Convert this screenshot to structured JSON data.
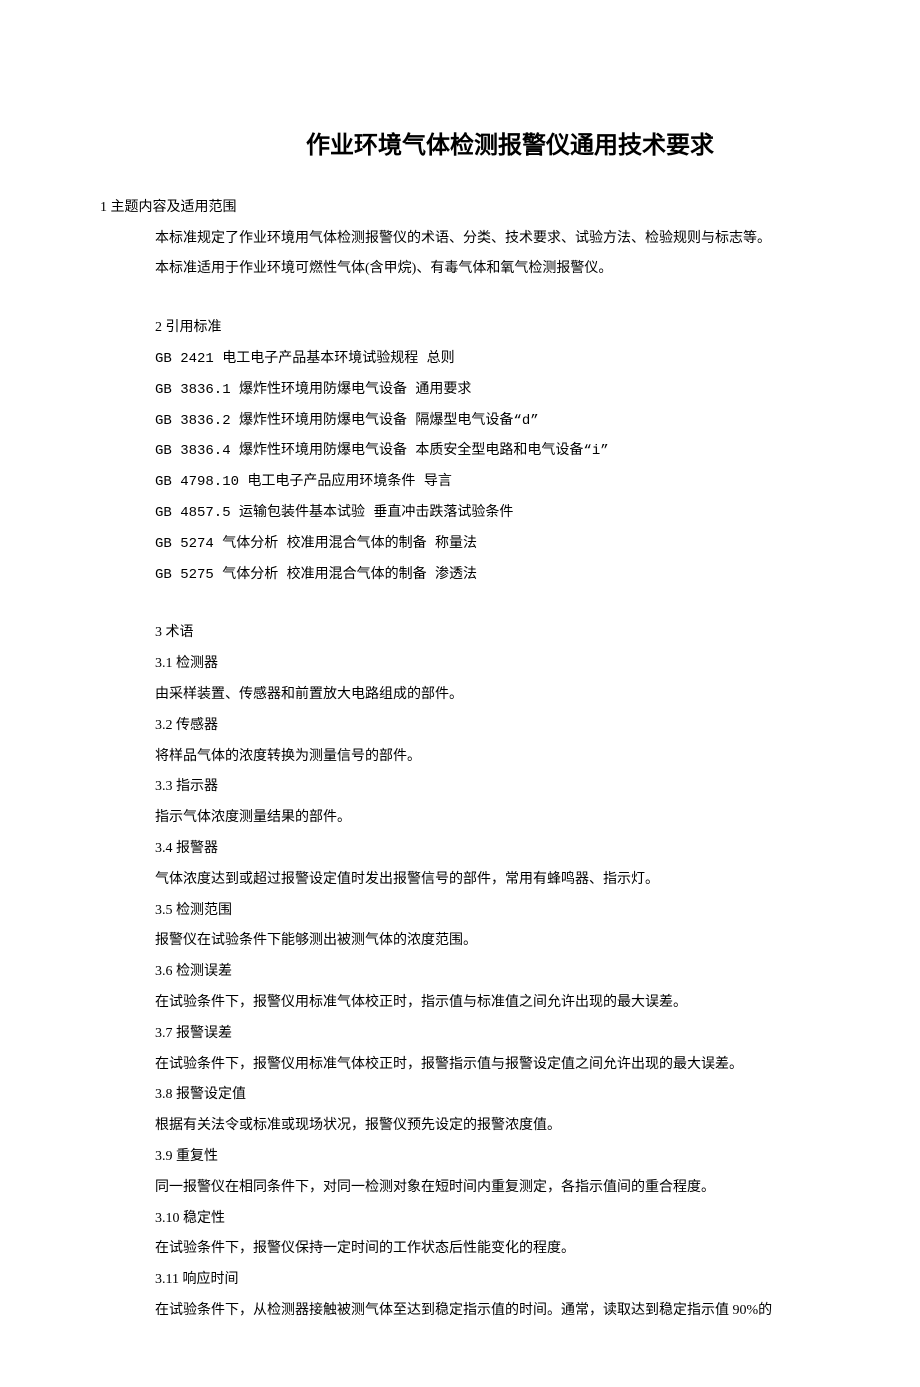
{
  "title": "作业环境气体检测报警仪通用技术要求",
  "section1": {
    "heading": "1  主题内容及适用范围",
    "para1": "本标准规定了作业环境用气体检测报警仪的术语、分类、技术要求、试验方法、检验规则与标志等。",
    "para2": "本标准适用于作业环境可燃性气体(含甲烷)、有毒气体和氧气检测报警仪。"
  },
  "section2": {
    "heading": "2  引用标准",
    "refs": [
      "GB 2421  电工电子产品基本环境试验规程  总则",
      "GB 3836.1  爆炸性环境用防爆电气设备  通用要求",
      "GB 3836.2  爆炸性环境用防爆电气设备  隔爆型电气设备“d”",
      "GB 3836.4  爆炸性环境用防爆电气设备  本质安全型电路和电气设备“i”",
      "GB 4798.10  电工电子产品应用环境条件  导言",
      "GB 4857.5  运输包装件基本试验  垂直冲击跌落试验条件",
      "GB 5274  气体分析  校准用混合气体的制备  称量法",
      "GB 5275  气体分析  校准用混合气体的制备  渗透法"
    ]
  },
  "section3": {
    "heading": "3  术语",
    "terms": [
      {
        "num": "3.1  检测器",
        "def": "由采样装置、传感器和前置放大电路组成的部件。"
      },
      {
        "num": "3.2  传感器",
        "def": "将样品气体的浓度转换为测量信号的部件。"
      },
      {
        "num": "3.3  指示器",
        "def": "指示气体浓度测量结果的部件。"
      },
      {
        "num": "3.4  报警器",
        "def": "气体浓度达到或超过报警设定值时发出报警信号的部件，常用有蜂鸣器、指示灯。"
      },
      {
        "num": "3.5  检测范围",
        "def": "报警仪在试验条件下能够测出被测气体的浓度范围。"
      },
      {
        "num": "3.6  检测误差",
        "def": "在试验条件下，报警仪用标准气体校正时，指示值与标准值之间允许出现的最大误差。"
      },
      {
        "num": "3.7  报警误差",
        "def": "在试验条件下，报警仪用标准气体校正时，报警指示值与报警设定值之间允许出现的最大误差。"
      },
      {
        "num": "3.8  报警设定值",
        "def": "根据有关法令或标准或现场状况，报警仪预先设定的报警浓度值。"
      },
      {
        "num": "3.9  重复性",
        "def": "同一报警仪在相同条件下，对同一检测对象在短时间内重复测定，各指示值间的重合程度。"
      },
      {
        "num": "3.10  稳定性",
        "def": "在试验条件下，报警仪保持一定时间的工作状态后性能变化的程度。"
      },
      {
        "num": "3.11  响应时间",
        "def": "在试验条件下，从检测器接触被测气体至达到稳定指示值的时间。通常，读取达到稳定指示值 90%的"
      }
    ]
  }
}
